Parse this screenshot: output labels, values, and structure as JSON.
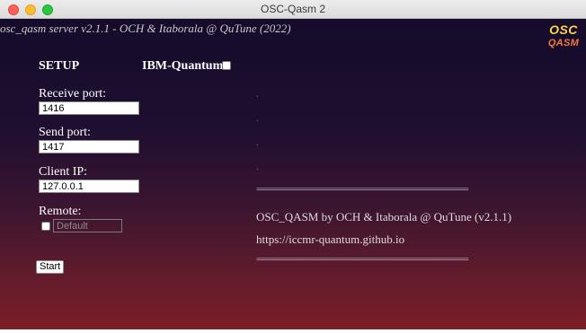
{
  "window": {
    "title": "OSC-Qasm 2"
  },
  "header": {
    "server_text": "osc_qasm server v2.1.1 - OCH & Itaborala @ QuTune (2022)",
    "logo_line1": "OSC",
    "logo_line2": "QASM"
  },
  "setup": {
    "title": "SETUP",
    "ibm_label": "IBM-Quantum:",
    "ibm_checked": false,
    "receive_label": "Receive port:",
    "receive_value": "1416",
    "send_label": "Send port:",
    "send_value": "1417",
    "client_label": "Client IP:",
    "client_value": "127.0.0.1",
    "remote_label": "Remote:",
    "remote_checked": false,
    "remote_placeholder": "Default",
    "start_label": "Start"
  },
  "log": {
    "dots": [
      ".",
      ".",
      ".",
      "."
    ],
    "separator": "================================================",
    "line1": "OSC_QASM by OCH & Itaborala @ QuTune (v2.1.1)",
    "line2": "https://iccmr-quantum.github.io"
  }
}
